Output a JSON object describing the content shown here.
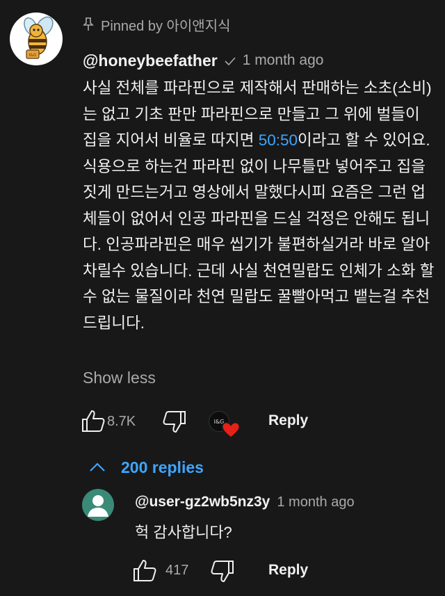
{
  "comment": {
    "pinned_label": "Pinned by 아이앤지식",
    "author": "@honeybeefather",
    "time": "1 month ago",
    "text_before": "사실 전체를 파라핀으로 제작해서 판매하는 소초(소비)는 없고 기초 판만 파라핀으로 만들고 그 위에 벌들이 집을 지어서 비율로 따지면 ",
    "text_highlight": "50:50",
    "text_after": "이라고 할 수 있어요. 식용으로 하는건 파라핀 없이 나무틀만 넣어주고 집을 짓게 만드는거고 영상에서 말했다시피 요즘은 그런 업체들이 없어서 인공 파라핀을 드실 걱정은 안해도 됩니다. 인공파라핀은 매우 씹기가 불편하실거라 바로 알아차릴수 있습니다. 근데 사실 천연밀랍도 인체가 소화 할 수 없는 물질이라 천연 밀랍도 꿀빨아먹고 뱉는걸 추천드립니다.",
    "show_less": "Show less",
    "like_count": "8.7K",
    "creator_badge": "I&G",
    "reply_label": "Reply"
  },
  "replies_toggle": "200 replies",
  "reply": {
    "author": "@user-gz2wb5nz3y",
    "time": "1 month ago",
    "text": "헉 감사합니다?",
    "like_count": "417",
    "reply_label": "Reply"
  },
  "colors": {
    "background": "#181818",
    "link": "#3ea6ff",
    "secondary_text": "#aaaaaa",
    "reply_avatar": "#3a8a78",
    "heart": "#e62117"
  }
}
